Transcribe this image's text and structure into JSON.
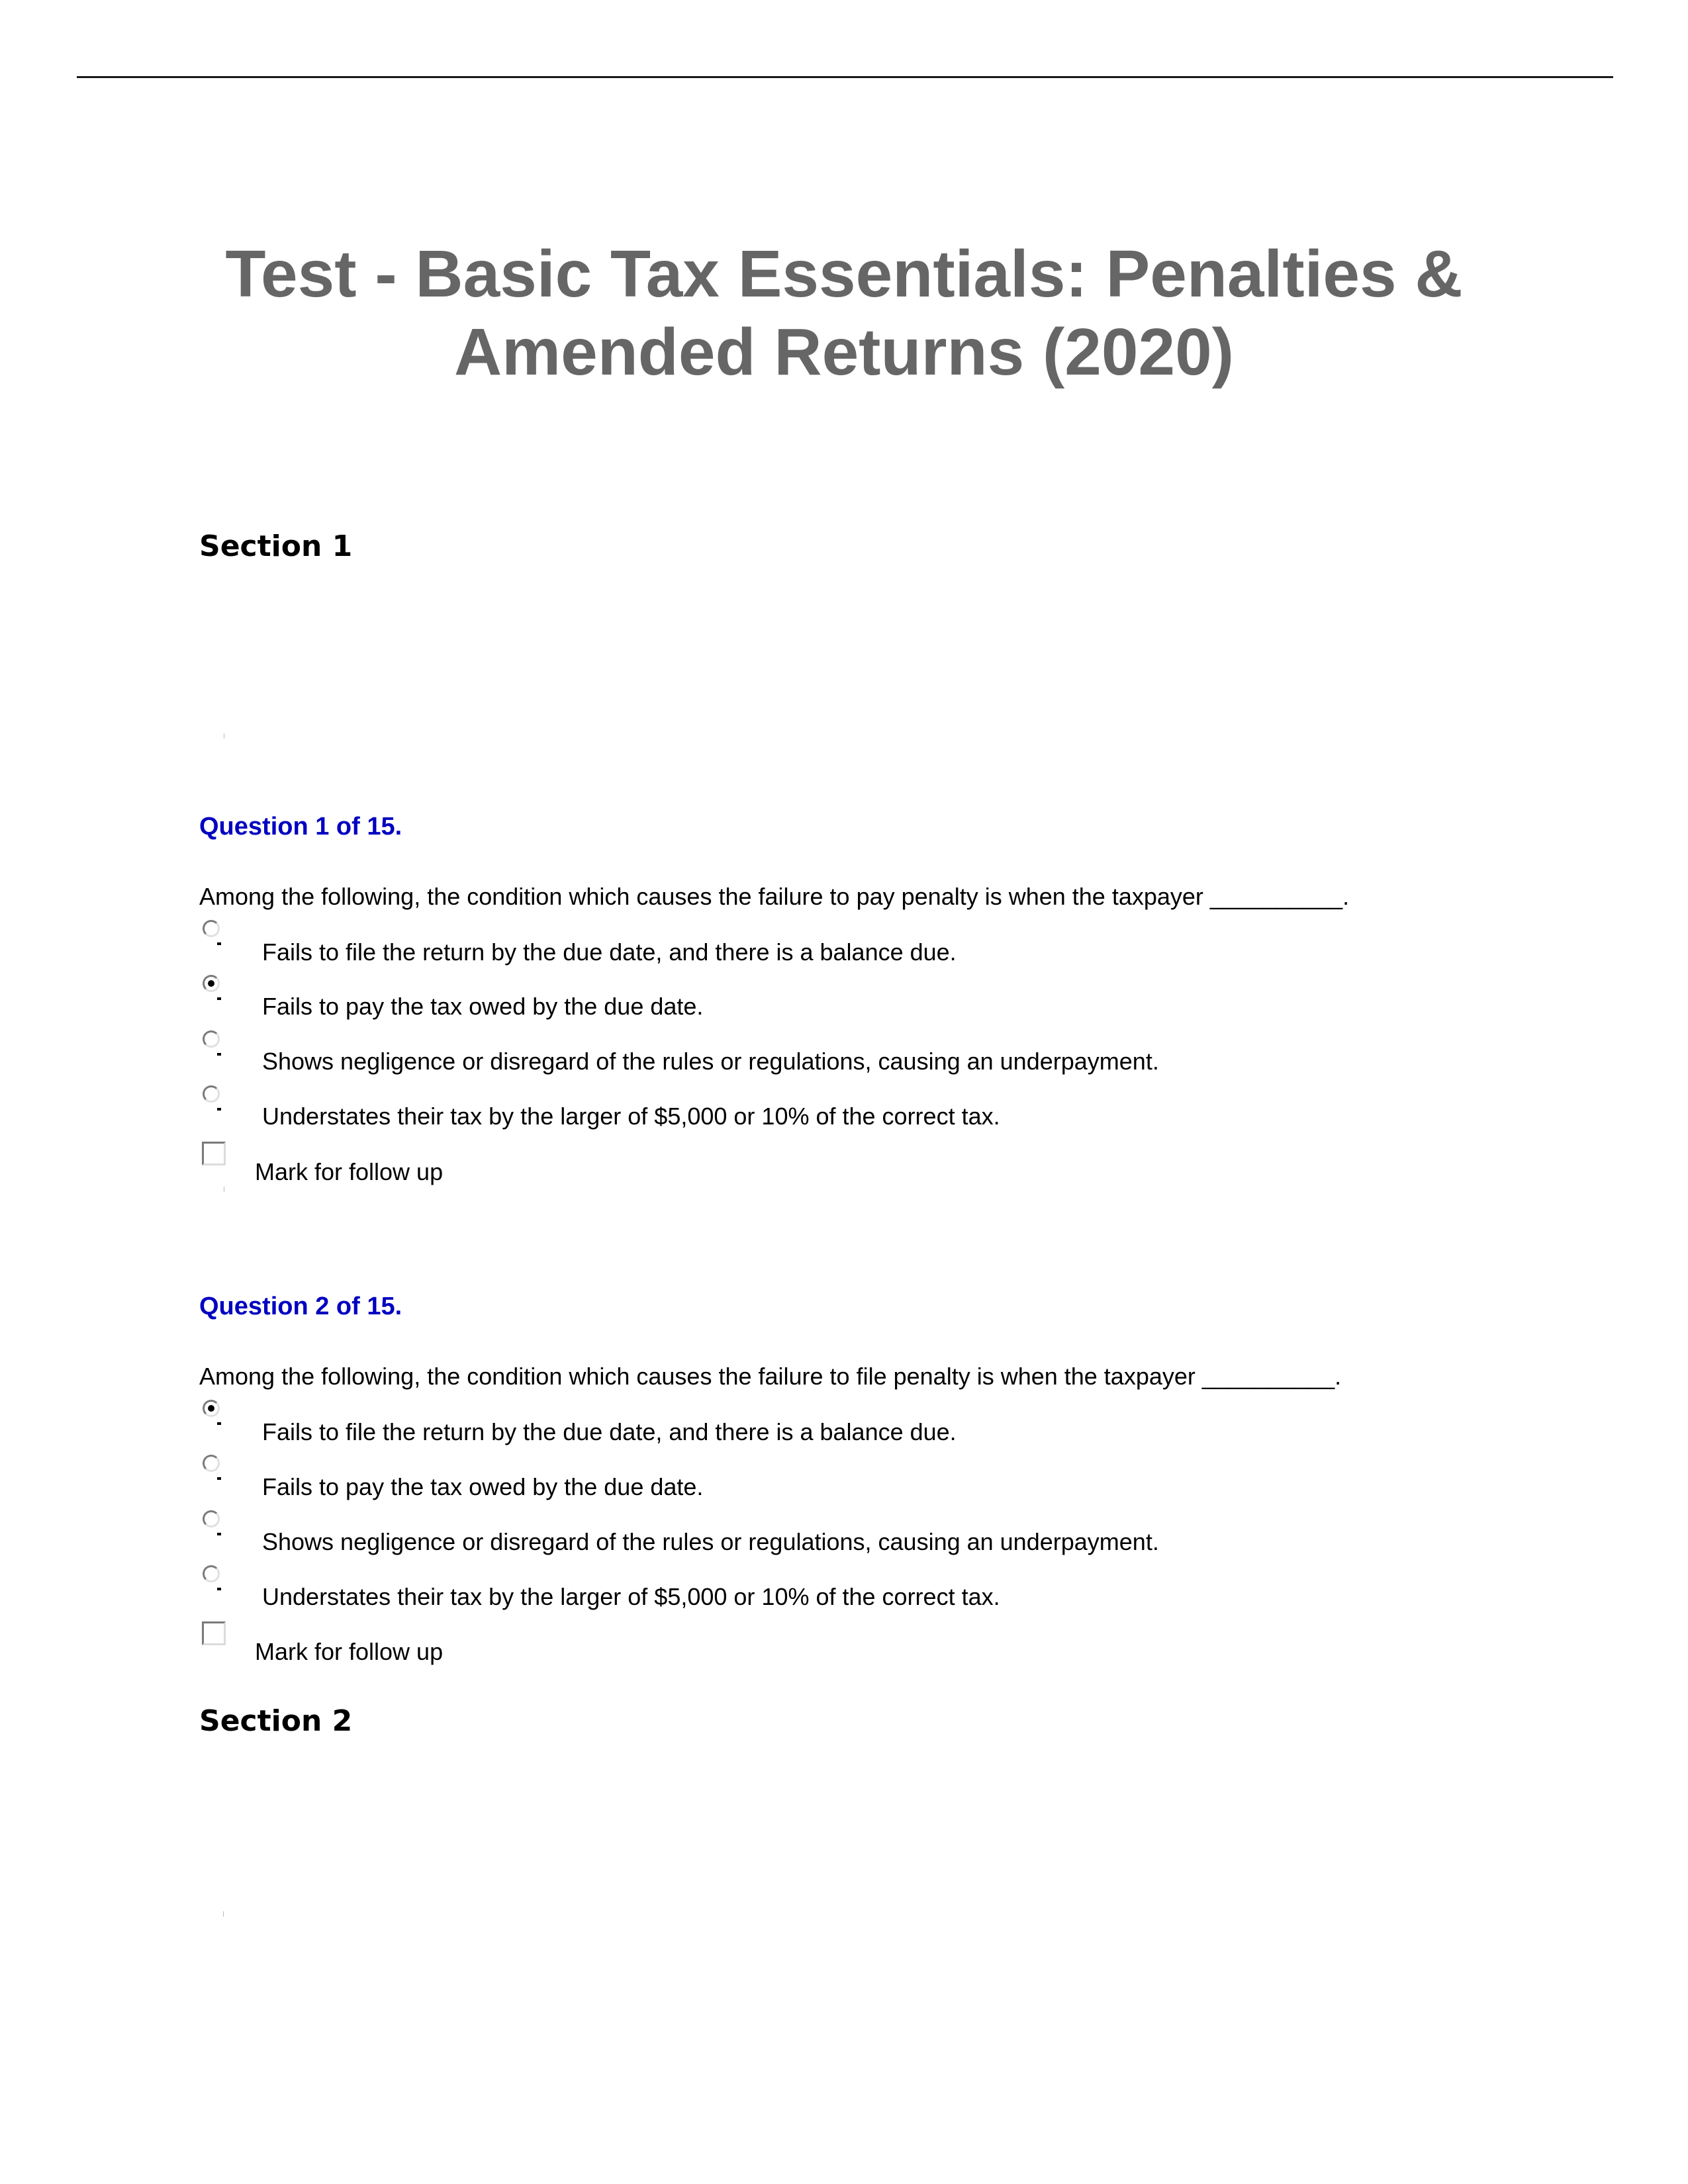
{
  "title": {
    "line1": "Test - Basic Tax Essentials: Penalties &",
    "line2": "Amended Returns (2020)"
  },
  "colors": {
    "title": "#666666",
    "question_heading": "#0000c0",
    "text": "#000000"
  },
  "sections": [
    {
      "label": "Section 1"
    },
    {
      "label": "Section 2"
    }
  ],
  "questions": [
    {
      "heading": "Question 1 of 15.",
      "text": "Among the following, the condition which causes the failure to pay penalty is when the taxpayer __________.",
      "options": [
        {
          "label": "Fails to file the return by the due date, and there is a balance due.",
          "selected": false
        },
        {
          "label": "Fails to pay the tax owed by the due date.",
          "selected": true
        },
        {
          "label": "Shows negligence or disregard of the rules or regulations, causing an underpayment.",
          "selected": false
        },
        {
          "label": "Understates their tax by the larger of $5,000 or 10% of the correct tax.",
          "selected": false
        }
      ],
      "follow_up": {
        "label": "Mark for follow up",
        "checked": false
      }
    },
    {
      "heading": "Question 2 of 15.",
      "text": "Among the following, the condition which causes the failure to file penalty is when the taxpayer __________.",
      "options": [
        {
          "label": "Fails to file the return by the due date, and there is a balance due.",
          "selected": true
        },
        {
          "label": "Fails to pay the tax owed by the due date.",
          "selected": false
        },
        {
          "label": "Shows negligence or disregard of the rules or regulations, causing an underpayment.",
          "selected": false
        },
        {
          "label": "Understates their tax by the larger of $5,000 or 10% of the correct tax.",
          "selected": false
        }
      ],
      "follow_up": {
        "label": "Mark for follow up",
        "checked": false
      }
    }
  ]
}
